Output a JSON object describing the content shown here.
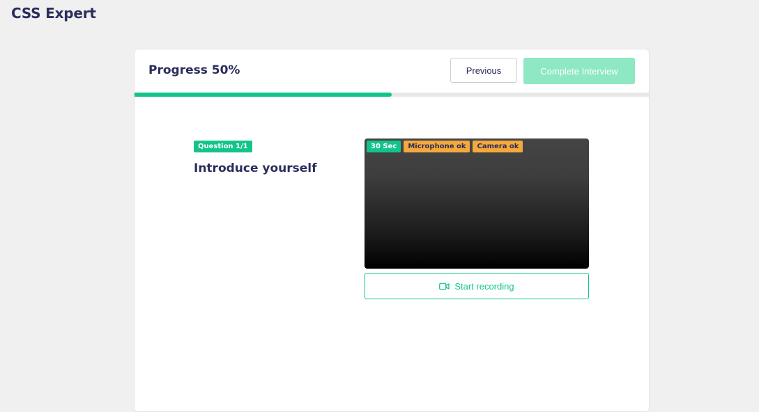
{
  "app": {
    "title": "CSS Expert"
  },
  "header": {
    "progress_label": "Progress 50%",
    "progress_fraction": 0.5,
    "previous_label": "Previous",
    "complete_label": "Complete Interview"
  },
  "question": {
    "badge": "Question 1/1",
    "text": "Introduce yourself"
  },
  "video": {
    "badges": {
      "timer": "30 Sec",
      "microphone": "Microphone ok",
      "camera": "Camera ok"
    },
    "record_label": "Start recording",
    "record_icon": "video-camera-icon"
  },
  "colors": {
    "accent": "#12c48b",
    "accent_light": "#8ee8c2",
    "warning": "#f5a93b",
    "text_primary": "#2b2d5c",
    "background": "#f0f0f0"
  }
}
